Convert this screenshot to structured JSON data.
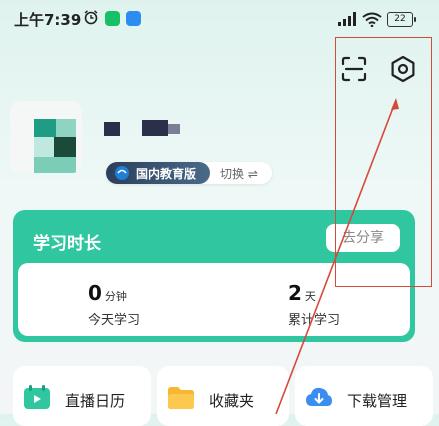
{
  "status_bar": {
    "time": "上午7:39",
    "battery": "22"
  },
  "header": {
    "icons": [
      "scan-icon",
      "settings-icon"
    ]
  },
  "profile": {
    "edition_label": "国内教育版",
    "switch_label": "切换 ⇌"
  },
  "study": {
    "title": "学习时长",
    "share_label": "去分享",
    "today": {
      "value": "0",
      "unit": "分钟",
      "label": "今天学习"
    },
    "total": {
      "value": "2",
      "unit": "天",
      "label": "累计学习"
    }
  },
  "quick_actions": [
    {
      "label": "直播日历",
      "icon": "calendar-play-icon"
    },
    {
      "label": "收藏夹",
      "icon": "folder-icon"
    },
    {
      "label": "下载管理",
      "icon": "cloud-download-icon"
    }
  ],
  "colors": {
    "accent": "#2fc6a0",
    "annotation": "#d64a3c"
  }
}
